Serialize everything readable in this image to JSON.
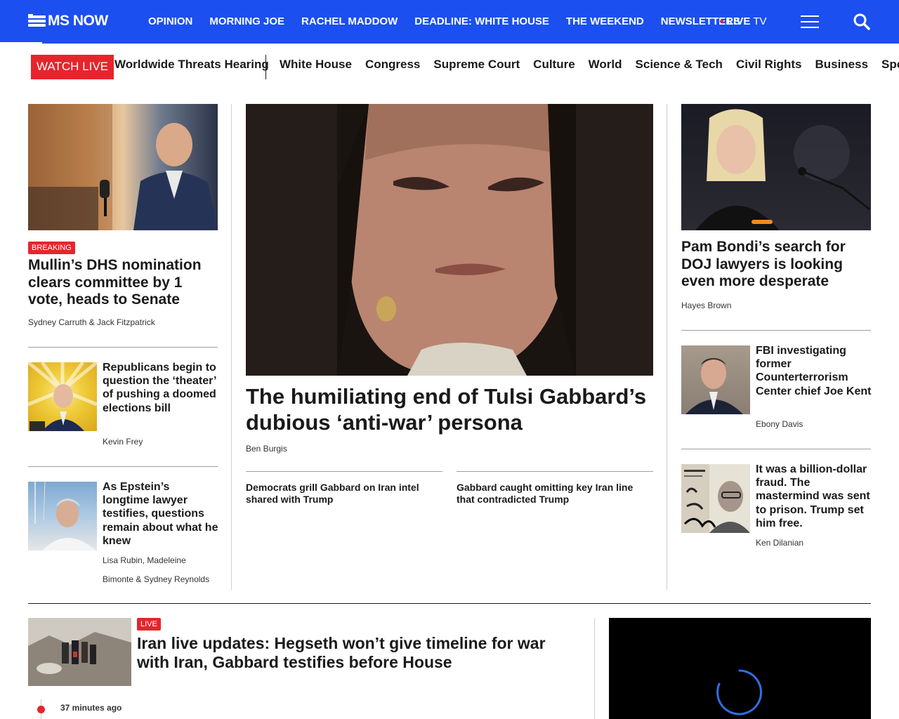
{
  "brand": {
    "name": "MS NOW",
    "accent": "#1c4ff0",
    "alert": "#e4262c"
  },
  "nav": {
    "links": [
      "OPINION",
      "MORNING JOE",
      "RACHEL MADDOW",
      "DEADLINE: WHITE HOUSE",
      "THE WEEKEND",
      "NEWSLETTERS"
    ],
    "live_label": "LIVE",
    "tv_label": "TV",
    "menu_icon": "hamburger-icon",
    "search_icon": "search-icon"
  },
  "subbar": {
    "watch_live": "WATCH LIVE",
    "featured": "Worldwide Threats Hearing",
    "topics": [
      "White House",
      "Congress",
      "Supreme Court",
      "Culture",
      "World",
      "Science & Tech",
      "Civil Rights",
      "Business",
      "Sports"
    ]
  },
  "left": {
    "lead": {
      "badge": "BREAKING",
      "headline": "Mullin’s DHS nomination clears committee by 1 vote, heads to Senate",
      "byline": "Sydney Carruth & Jack Fitzpatrick"
    },
    "items": [
      {
        "headline": "Republicans begin to question the ‘theater’ of pushing a doomed elections bill",
        "byline": "Kevin Frey"
      },
      {
        "headline": "As Epstein’s longtime lawyer testifies, questions remain about what he knew",
        "byline_1": "Lisa Rubin, Madeleine",
        "byline_2": "Bimonte & Sydney Reynolds"
      }
    ]
  },
  "center": {
    "headline": "The humiliating end of Tulsi Gabbard’s dubious ‘anti-war’ persona",
    "byline": "Ben Burgis",
    "related": [
      "Democrats grill Gabbard on Iran intel shared with Trump",
      "Gabbard caught omitting key Iran line that contradicted Trump"
    ]
  },
  "right": {
    "lead": {
      "headline": "Pam Bondi’s search for DOJ lawyers is looking even more desperate",
      "byline": "Hayes Brown"
    },
    "items": [
      {
        "headline": "FBI investigating former Counterterrorism Center chief Joe Kent",
        "byline": "Ebony Davis"
      },
      {
        "headline": "It was a billion-dollar fraud. The mastermind was sent to prison. Trump set him free.",
        "byline": "Ken Dilanian"
      }
    ]
  },
  "live_story": {
    "badge": "LIVE",
    "headline": "Iran live updates: Hegseth won’t give timeline for war with Iran, Gabbard testifies before House",
    "timestamp": "37 minutes ago"
  }
}
